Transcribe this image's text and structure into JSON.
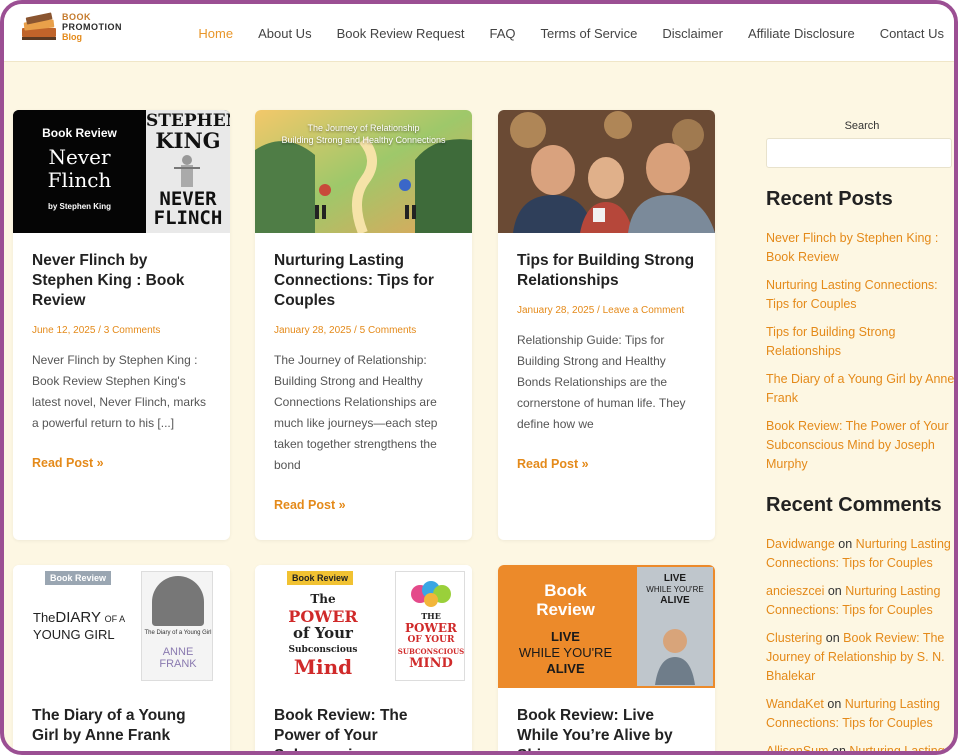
{
  "logo": {
    "line1": "BOOK",
    "line2": "PROMOTION",
    "line3": "Blog"
  },
  "nav": [
    {
      "label": "Home",
      "active": true
    },
    {
      "label": "About Us"
    },
    {
      "label": "Book Review Request"
    },
    {
      "label": "FAQ"
    },
    {
      "label": "Terms of Service"
    },
    {
      "label": "Disclaimer"
    },
    {
      "label": "Affiliate Disclosure"
    },
    {
      "label": "Contact Us"
    }
  ],
  "posts": [
    {
      "title": "Never Flinch by Stephen King : Book Review",
      "date": "June 12, 2025",
      "comments": "3 Comments",
      "excerpt": "Never Flinch by Stephen King : Book Review Stephen King's latest novel, Never Flinch, marks a powerful return to his [...]",
      "read_more": "Read Post »",
      "thumb": {
        "badge": "Book Review",
        "book_title_1": "Never",
        "book_title_2": "Flinch",
        "byline": "by Stephen King",
        "cover_author_1": "STEPHEN",
        "cover_author_2": "KING",
        "cover_title_1": "NEVER",
        "cover_title_2": "FLINCH"
      }
    },
    {
      "title": "Nurturing Lasting Connections: Tips for Couples",
      "date": "January 28, 2025",
      "comments": "5 Comments",
      "excerpt": "The Journey of Relationship: Building Strong and Healthy Connections Relationships are much like journeys—each step taken together strengthens the bond",
      "read_more": "Read Post »",
      "thumb": {
        "caption_1": "The Journey of Relationship",
        "caption_2": "Building Strong and Healthy Connections"
      }
    },
    {
      "title": "Tips for Building Strong Relationships",
      "date": "January 28, 2025",
      "comments": "Leave a Comment",
      "excerpt": "Relationship Guide: Tips for Building Strong and Healthy Bonds Relationships are the cornerstone of human life. They define how we",
      "read_more": "Read Post »"
    },
    {
      "title": "The Diary of a Young Girl by Anne Frank",
      "thumb": {
        "badge": "Book Review",
        "t1": "The",
        "t2": "DIARY",
        "t3": "OF A",
        "t4": "YOUNG GIRL",
        "cover_1": "The Diary of a Young Girl",
        "cover_2": "ANNE",
        "cover_3": "FRANK"
      }
    },
    {
      "title": "Book Review: The Power of Your Subconscious",
      "thumb": {
        "badge": "Book Review",
        "t1": "The",
        "t2": "POWER",
        "t3": "of Your",
        "t4": "Subconscious",
        "t5": "Mind",
        "cover_1": "THE",
        "cover_2": "POWER",
        "cover_3": "OF YOUR",
        "cover_4": "SUBCONSCIOUS",
        "cover_5": "MIND"
      }
    },
    {
      "title": "Book Review: Live While You’re Alive by Shiv",
      "thumb": {
        "b1": "Book",
        "b2": "Review",
        "t1": "LIVE",
        "t2": "WHILE YOU'RE",
        "t3": "ALIVE",
        "cover_1": "LIVE",
        "cover_2": "WHILE YOU'RE",
        "cover_3": "ALIVE"
      }
    }
  ],
  "sidebar": {
    "search_label": "Search",
    "recent_posts_heading": "Recent Posts",
    "recent_posts": [
      "Never Flinch by Stephen King : Book Review",
      "Nurturing Lasting Connections: Tips for Couples",
      "Tips for Building Strong Relationships",
      "The Diary of a Young Girl by Anne Frank",
      "Book Review: The Power of Your Subconscious Mind by Joseph Murphy"
    ],
    "recent_comments_heading": "Recent Comments",
    "recent_comments": [
      {
        "author": "Davidwange",
        "on": "on",
        "post": "Nurturing Lasting Connections: Tips for Couples"
      },
      {
        "author": "ancieszcei",
        "on": "on",
        "post": "Nurturing Lasting Connections: Tips for Couples"
      },
      {
        "author": "Clustering",
        "on": "on",
        "post": "Book Review: The Journey of Relationship by S. N. Bhalekar"
      },
      {
        "author": "WandaKet",
        "on": "on",
        "post": "Nurturing Lasting Connections: Tips for Couples"
      },
      {
        "author": "AllisonSum",
        "on": "on",
        "post": "Nurturing Lasting Connections: Tips for Couples"
      }
    ]
  },
  "colors": {
    "accent": "#e48a1a",
    "frame": "#9b4f93",
    "background": "#fdf7e3"
  }
}
